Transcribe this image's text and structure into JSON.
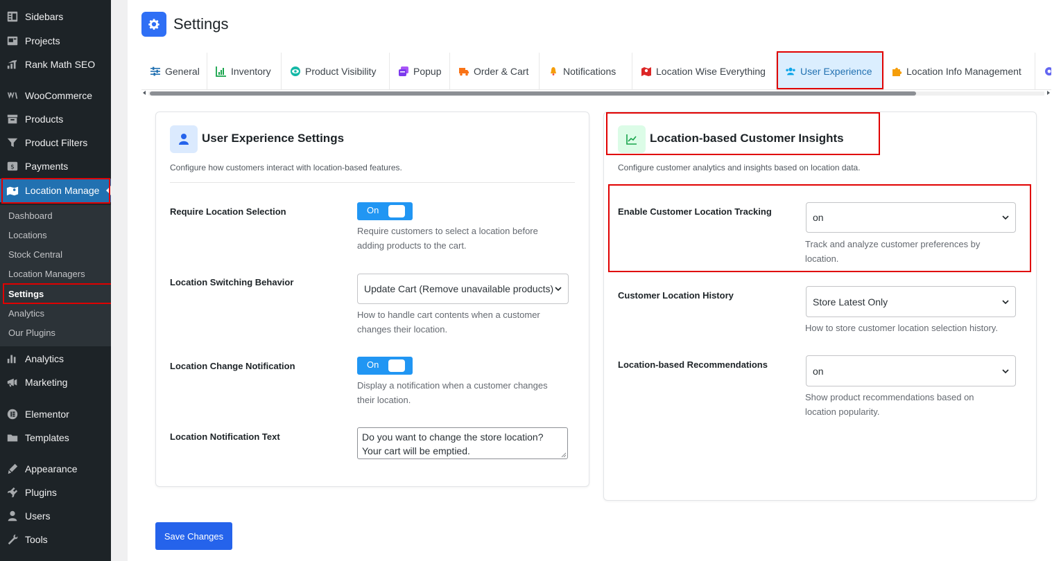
{
  "sidebar": {
    "items": [
      {
        "label": "Sidebars",
        "icon": "sidebars-icon"
      },
      {
        "label": "Projects",
        "icon": "projects-icon"
      },
      {
        "label": "Rank Math SEO",
        "icon": "rank-math-icon"
      },
      {
        "label": "WooCommerce",
        "icon": "woocommerce-icon"
      },
      {
        "label": "Products",
        "icon": "products-icon"
      },
      {
        "label": "Product Filters",
        "icon": "filter-icon"
      },
      {
        "label": "Payments",
        "icon": "payments-icon"
      },
      {
        "label": "Location Manage",
        "icon": "location-map-icon"
      },
      {
        "label": "Analytics",
        "icon": "analytics-icon"
      },
      {
        "label": "Marketing",
        "icon": "marketing-icon"
      },
      {
        "label": "Elementor",
        "icon": "elementor-icon"
      },
      {
        "label": "Templates",
        "icon": "folder-icon"
      },
      {
        "label": "Appearance",
        "icon": "appearance-icon"
      },
      {
        "label": "Plugins",
        "icon": "plugins-icon"
      },
      {
        "label": "Users",
        "icon": "users-icon"
      },
      {
        "label": "Tools",
        "icon": "tools-icon"
      }
    ],
    "submenu": [
      "Dashboard",
      "Locations",
      "Stock Central",
      "Location Managers",
      "Settings",
      "Analytics",
      "Our Plugins"
    ]
  },
  "header": {
    "title": "Settings",
    "icon": "gear-icon"
  },
  "tabs": [
    {
      "label": "General",
      "icon": "sliders-icon"
    },
    {
      "label": "Inventory",
      "icon": "chart-icon"
    },
    {
      "label": "Product Visibility",
      "icon": "eye-icon"
    },
    {
      "label": "Popup",
      "icon": "popup-icon"
    },
    {
      "label": "Order & Cart",
      "icon": "truck-icon"
    },
    {
      "label": "Notifications",
      "icon": "bell-icon"
    },
    {
      "label": "Location Wise Everything",
      "icon": "map-icon"
    },
    {
      "label": "User Experience",
      "icon": "users-icon"
    },
    {
      "label": "Location Info Management",
      "icon": "puzzle-icon"
    }
  ],
  "user_experience": {
    "title": "User Experience Settings",
    "description": "Configure how customers interact with location-based features.",
    "fields": {
      "require_location": {
        "label": "Require Location Selection",
        "value": "On",
        "help1": "Require customers to select a location before",
        "help2": "adding products to the cart."
      },
      "switching_behavior": {
        "label": "Location Switching Behavior",
        "value": "Update Cart (Remove unavailable products)",
        "help1": "How to handle cart contents when a customer",
        "help2": "changes their location."
      },
      "change_notification": {
        "label": "Location Change Notification",
        "value": "On",
        "help1": "Display a notification when a customer changes",
        "help2": "their location."
      },
      "notification_text": {
        "label": "Location Notification Text",
        "line1": "Do you want to change the store location?",
        "line2": "Your cart will be emptied."
      }
    }
  },
  "insights": {
    "title": "Location-based Customer Insights",
    "description": "Configure customer analytics and insights based on location data.",
    "fields": {
      "tracking": {
        "label": "Enable Customer Location Tracking",
        "value": "on",
        "help1": "Track and analyze customer preferences by",
        "help2": "location."
      },
      "history": {
        "label": "Customer Location History",
        "value": "Store Latest Only",
        "help1": "How to store customer location selection history."
      },
      "recommendations": {
        "label": "Location-based Recommendations",
        "value": "on",
        "help1": "Show product recommendations based on",
        "help2": "location popularity."
      }
    }
  },
  "save_button": "Save Changes",
  "colors": {
    "accent": "#2271b1",
    "toggle": "#2196f3",
    "save": "#2563eb",
    "highlight": "#e00000"
  }
}
